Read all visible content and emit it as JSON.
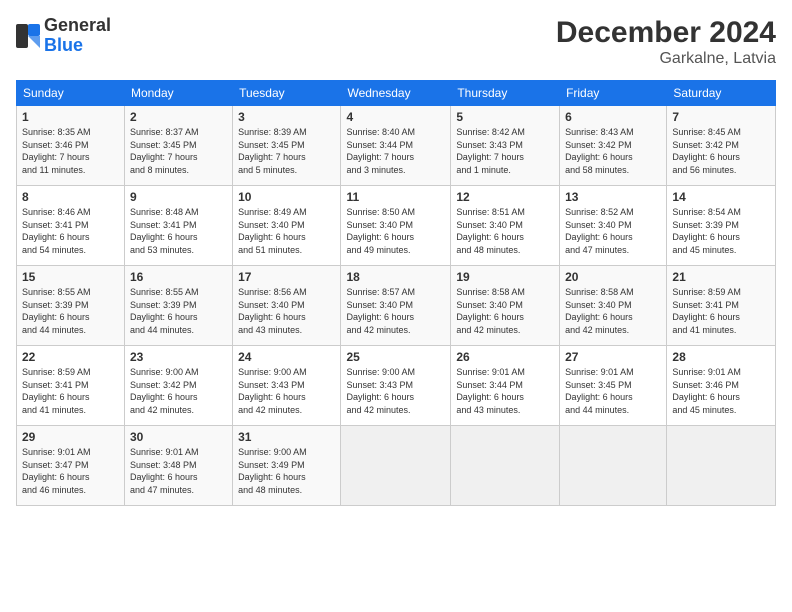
{
  "header": {
    "logo_general": "General",
    "logo_blue": "Blue",
    "month_year": "December 2024",
    "location": "Garkalne, Latvia"
  },
  "days_of_week": [
    "Sunday",
    "Monday",
    "Tuesday",
    "Wednesday",
    "Thursday",
    "Friday",
    "Saturday"
  ],
  "weeks": [
    [
      {
        "day": "1",
        "sunrise": "8:35 AM",
        "sunset": "3:46 PM",
        "daylight": "7 hours and 11 minutes."
      },
      {
        "day": "2",
        "sunrise": "8:37 AM",
        "sunset": "3:45 PM",
        "daylight": "7 hours and 8 minutes."
      },
      {
        "day": "3",
        "sunrise": "8:39 AM",
        "sunset": "3:45 PM",
        "daylight": "7 hours and 5 minutes."
      },
      {
        "day": "4",
        "sunrise": "8:40 AM",
        "sunset": "3:44 PM",
        "daylight": "7 hours and 3 minutes."
      },
      {
        "day": "5",
        "sunrise": "8:42 AM",
        "sunset": "3:43 PM",
        "daylight": "7 hours and 1 minute."
      },
      {
        "day": "6",
        "sunrise": "8:43 AM",
        "sunset": "3:42 PM",
        "daylight": "6 hours and 58 minutes."
      },
      {
        "day": "7",
        "sunrise": "8:45 AM",
        "sunset": "3:42 PM",
        "daylight": "6 hours and 56 minutes."
      }
    ],
    [
      {
        "day": "8",
        "sunrise": "8:46 AM",
        "sunset": "3:41 PM",
        "daylight": "6 hours and 54 minutes."
      },
      {
        "day": "9",
        "sunrise": "8:48 AM",
        "sunset": "3:41 PM",
        "daylight": "6 hours and 53 minutes."
      },
      {
        "day": "10",
        "sunrise": "8:49 AM",
        "sunset": "3:40 PM",
        "daylight": "6 hours and 51 minutes."
      },
      {
        "day": "11",
        "sunrise": "8:50 AM",
        "sunset": "3:40 PM",
        "daylight": "6 hours and 49 minutes."
      },
      {
        "day": "12",
        "sunrise": "8:51 AM",
        "sunset": "3:40 PM",
        "daylight": "6 hours and 48 minutes."
      },
      {
        "day": "13",
        "sunrise": "8:52 AM",
        "sunset": "3:40 PM",
        "daylight": "6 hours and 47 minutes."
      },
      {
        "day": "14",
        "sunrise": "8:54 AM",
        "sunset": "3:39 PM",
        "daylight": "6 hours and 45 minutes."
      }
    ],
    [
      {
        "day": "15",
        "sunrise": "8:55 AM",
        "sunset": "3:39 PM",
        "daylight": "6 hours and 44 minutes."
      },
      {
        "day": "16",
        "sunrise": "8:55 AM",
        "sunset": "3:39 PM",
        "daylight": "6 hours and 44 minutes."
      },
      {
        "day": "17",
        "sunrise": "8:56 AM",
        "sunset": "3:40 PM",
        "daylight": "6 hours and 43 minutes."
      },
      {
        "day": "18",
        "sunrise": "8:57 AM",
        "sunset": "3:40 PM",
        "daylight": "6 hours and 42 minutes."
      },
      {
        "day": "19",
        "sunrise": "8:58 AM",
        "sunset": "3:40 PM",
        "daylight": "6 hours and 42 minutes."
      },
      {
        "day": "20",
        "sunrise": "8:58 AM",
        "sunset": "3:40 PM",
        "daylight": "6 hours and 42 minutes."
      },
      {
        "day": "21",
        "sunrise": "8:59 AM",
        "sunset": "3:41 PM",
        "daylight": "6 hours and 41 minutes."
      }
    ],
    [
      {
        "day": "22",
        "sunrise": "8:59 AM",
        "sunset": "3:41 PM",
        "daylight": "6 hours and 41 minutes."
      },
      {
        "day": "23",
        "sunrise": "9:00 AM",
        "sunset": "3:42 PM",
        "daylight": "6 hours and 42 minutes."
      },
      {
        "day": "24",
        "sunrise": "9:00 AM",
        "sunset": "3:43 PM",
        "daylight": "6 hours and 42 minutes."
      },
      {
        "day": "25",
        "sunrise": "9:00 AM",
        "sunset": "3:43 PM",
        "daylight": "6 hours and 42 minutes."
      },
      {
        "day": "26",
        "sunrise": "9:01 AM",
        "sunset": "3:44 PM",
        "daylight": "6 hours and 43 minutes."
      },
      {
        "day": "27",
        "sunrise": "9:01 AM",
        "sunset": "3:45 PM",
        "daylight": "6 hours and 44 minutes."
      },
      {
        "day": "28",
        "sunrise": "9:01 AM",
        "sunset": "3:46 PM",
        "daylight": "6 hours and 45 minutes."
      }
    ],
    [
      {
        "day": "29",
        "sunrise": "9:01 AM",
        "sunset": "3:47 PM",
        "daylight": "6 hours and 46 minutes."
      },
      {
        "day": "30",
        "sunrise": "9:01 AM",
        "sunset": "3:48 PM",
        "daylight": "6 hours and 47 minutes."
      },
      {
        "day": "31",
        "sunrise": "9:00 AM",
        "sunset": "3:49 PM",
        "daylight": "6 hours and 48 minutes."
      },
      null,
      null,
      null,
      null
    ]
  ]
}
